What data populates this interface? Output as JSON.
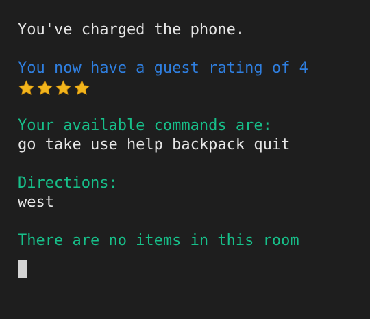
{
  "terminal": {
    "message": "You've charged the phone.",
    "rating_text": "You now have a guest rating of 4",
    "rating_stars": 4,
    "star_icon": "star-icon",
    "commands_heading": "Your available commands are:",
    "commands_list": "go take use help backpack quit",
    "directions_heading": "Directions:",
    "directions_list": "west",
    "items_text": "There are no items in this room"
  },
  "colors": {
    "background": "#1e1e1e",
    "text": "#e6e6e6",
    "blue": "#2f7fe0",
    "green": "#17c08a",
    "star": "#f2b51c"
  }
}
